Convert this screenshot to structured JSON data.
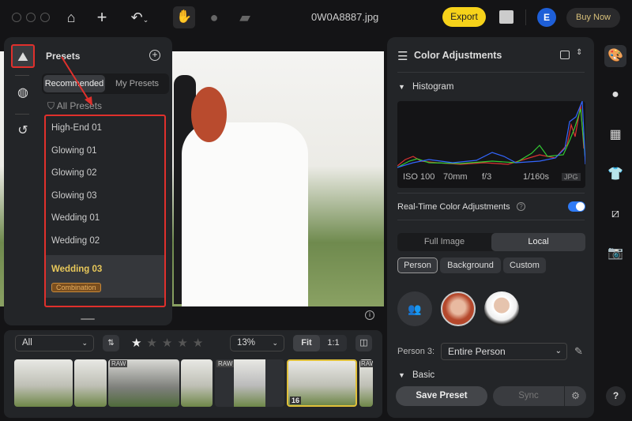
{
  "topbar": {
    "filename": "0W0A8887.jpg",
    "export_label": "Export",
    "avatar_letter": "E",
    "buy_label": "Buy Now"
  },
  "presets_panel": {
    "title": "Presets",
    "tabs": [
      "Recommended",
      "My Presets"
    ],
    "filter_label": "All Presets",
    "items": [
      "High-End 01",
      "Glowing 01",
      "Glowing 02",
      "Glowing 03",
      "Wedding 01",
      "Wedding 02"
    ],
    "selected": {
      "name": "Wedding 03",
      "badge": "Combination"
    }
  },
  "right_panel": {
    "title": "Color Adjustments",
    "histogram_label": "Histogram",
    "exif": {
      "iso": "ISO 100",
      "focal": "70mm",
      "aperture": "f/3",
      "shutter": "1/160s",
      "format": "JPG"
    },
    "realtime_label": "Real-Time Color Adjustments",
    "realtime_on": true,
    "mode_tabs": [
      "Full Image",
      "Local"
    ],
    "active_mode": "Local",
    "local_tabs": [
      "Person",
      "Background",
      "Custom"
    ],
    "active_local": "Person",
    "person_label": "Person 3:",
    "person_select": "Entire Person",
    "basic_label": "Basic",
    "save_preset": "Save Preset",
    "sync": "Sync"
  },
  "filmstrip": {
    "filter": "All",
    "zoom": "13%",
    "fit": "Fit",
    "one_to_one": "1:1",
    "rating": 1,
    "raw_badge": "RAW",
    "selected_count": "16"
  },
  "colors": {
    "accent": "#f6d21a",
    "highlight": "#e0302c",
    "toggle": "#2f7bf6",
    "avatar": "#1e5fd8"
  }
}
